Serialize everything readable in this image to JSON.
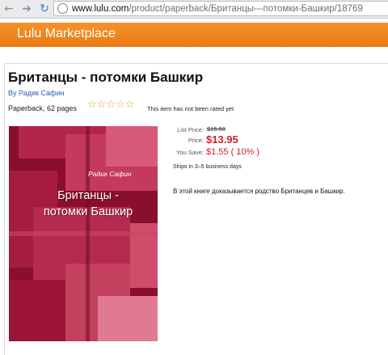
{
  "browser": {
    "url_host": "www.lulu.com",
    "url_path": "/product/paperback/Британцы---потомки-Башкир/18769"
  },
  "header": {
    "title": "Lulu Marketplace"
  },
  "product": {
    "title": "Британцы - потомки Башкир",
    "author_line": "By Радик Сафин",
    "format_line": "Paperback, 62 pages",
    "stars": "☆☆☆☆☆",
    "rating_note": "This item has not been rated yet",
    "list_price_label": "List Price:",
    "list_price": "$15.50",
    "price_label": "Price:",
    "price": "$13.95",
    "save_label": "You Save:",
    "save_value": "$1.55 ( 10% )",
    "shipping": "Ships in 3–5 business days",
    "description": "В этой книге доказывается родство Британцев и Башкир.",
    "cover": {
      "author": "Радик Сафин",
      "title_line1": "Британцы -",
      "title_line2": "потомки Башкир"
    }
  },
  "icons": {
    "back": "back-arrow-icon",
    "forward": "forward-arrow-icon",
    "reload": "reload-icon",
    "page": "page-globe-icon"
  },
  "colors": {
    "header_orange": "#f08a1f",
    "price_red": "#d0202a",
    "author_blue": "#2a5fb5",
    "cover_red": "#8e1230"
  }
}
